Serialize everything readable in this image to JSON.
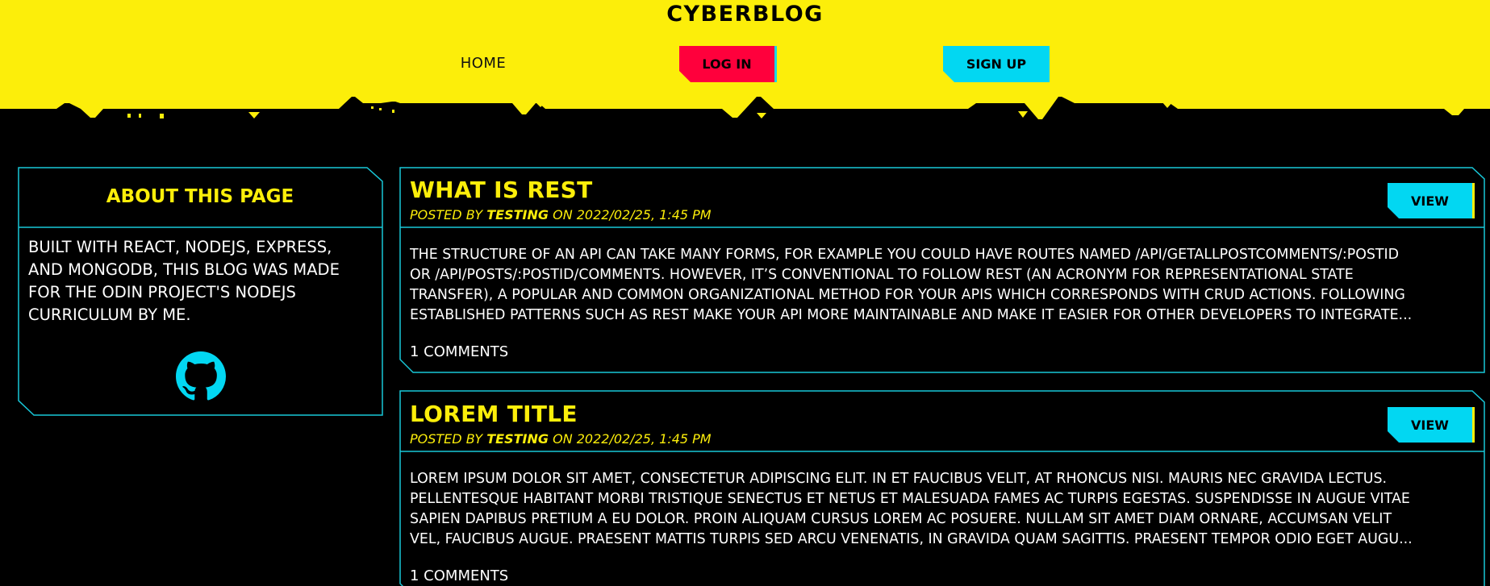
{
  "site": {
    "title": "CYBERBLOG"
  },
  "nav": {
    "home": "HOME",
    "login": "LOG IN",
    "signup": "SIGN UP"
  },
  "colors": {
    "accent_yellow": "#fcee0a",
    "accent_cyan": "#02d7f2",
    "accent_red": "#ff003c",
    "background": "#000000"
  },
  "about": {
    "title": "ABOUT THIS PAGE",
    "body": "BUILT WITH REACT, NODEJS, EXPRESS, AND MONGODB, THIS BLOG WAS MADE FOR THE ODIN PROJECT'S NODEJS CURRICULUM BY ME.",
    "icon": "github-icon"
  },
  "posts": [
    {
      "title": "WHAT IS REST",
      "meta_prefix": "POSTED BY ",
      "author": "TESTING",
      "meta_suffix": " ON 2022/02/25, 1:45 PM",
      "body_lines": [
        "THE STRUCTURE OF AN API CAN TAKE MANY FORMS, FOR EXAMPLE YOU COULD HAVE ROUTES NAMED /API/GETALLPOSTCOMMENTS/:POSTID",
        "OR /API/POSTS/:POSTID/COMMENTS. HOWEVER, IT’S CONVENTIONAL TO FOLLOW REST (AN ACRONYM FOR REPRESENTATIONAL STATE",
        "TRANSFER), A POPULAR AND COMMON ORGANIZATIONAL METHOD FOR YOUR APIS WHICH CORRESPONDS WITH CRUD ACTIONS. FOLLOWING",
        "ESTABLISHED PATTERNS SUCH AS REST MAKE YOUR API MORE MAINTAINABLE AND MAKE IT EASIER FOR OTHER DEVELOPERS TO INTEGRATE..."
      ],
      "comments": "1 COMMENTS",
      "view_label": "VIEW"
    },
    {
      "title": "LOREM TITLE",
      "meta_prefix": "POSTED BY ",
      "author": "TESTING",
      "meta_suffix": " ON 2022/02/25, 1:45 PM",
      "body_lines": [
        "LOREM IPSUM DOLOR SIT AMET, CONSECTETUR ADIPISCING ELIT. IN ET FAUCIBUS VELIT, AT RHONCUS NISI. MAURIS NEC GRAVIDA LECTUS.",
        "PELLENTESQUE HABITANT MORBI TRISTIQUE SENECTUS ET NETUS ET MALESUADA FAMES AC TURPIS EGESTAS. SUSPENDISSE IN AUGUE VITAE",
        "SAPIEN DAPIBUS PRETIUM A EU DOLOR. PROIN ALIQUAM CURSUS LOREM AC POSUERE. NULLAM SIT AMET DIAM ORNARE, ACCUMSAN VELIT",
        "VEL, FAUCIBUS AUGUE. PRAESENT MATTIS TURPIS SED ARCU VENENATIS, IN GRAVIDA QUAM SAGITTIS. PRAESENT TEMPOR ODIO EGET AUGU..."
      ],
      "comments": "1 COMMENTS",
      "view_label": "VIEW"
    }
  ]
}
